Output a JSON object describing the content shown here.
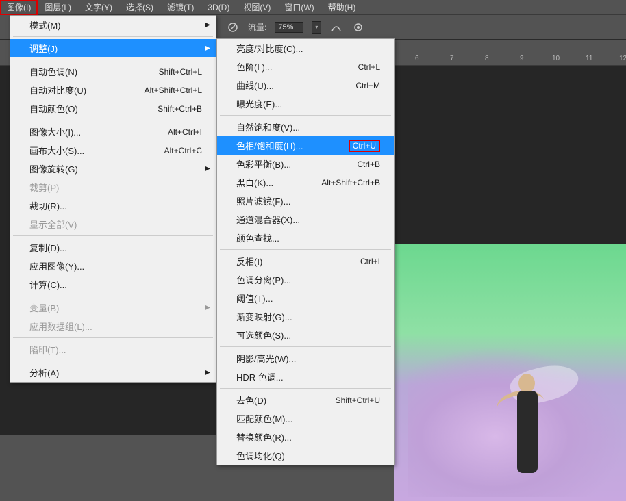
{
  "menubar": {
    "items": [
      "图像(I)",
      "图层(L)",
      "文字(Y)",
      "选择(S)",
      "滤镜(T)",
      "3D(D)",
      "视图(V)",
      "窗口(W)",
      "帮助(H)"
    ]
  },
  "toolbar": {
    "flow_label": "流量:",
    "flow_value": "75%"
  },
  "ruler": {
    "ticks": [
      "6",
      "7",
      "8",
      "9",
      "10",
      "11",
      "12"
    ]
  },
  "menu1": {
    "groups": [
      [
        {
          "label": "模式(M)",
          "arrow": true
        }
      ],
      [
        {
          "label": "调整(J)",
          "arrow": true,
          "hover": true
        }
      ],
      [
        {
          "label": "自动色调(N)",
          "sc": "Shift+Ctrl+L"
        },
        {
          "label": "自动对比度(U)",
          "sc": "Alt+Shift+Ctrl+L"
        },
        {
          "label": "自动颜色(O)",
          "sc": "Shift+Ctrl+B"
        }
      ],
      [
        {
          "label": "图像大小(I)...",
          "sc": "Alt+Ctrl+I"
        },
        {
          "label": "画布大小(S)...",
          "sc": "Alt+Ctrl+C"
        },
        {
          "label": "图像旋转(G)",
          "arrow": true
        },
        {
          "label": "裁剪(P)",
          "disabled": true
        },
        {
          "label": "裁切(R)..."
        },
        {
          "label": "显示全部(V)",
          "disabled": true
        }
      ],
      [
        {
          "label": "复制(D)..."
        },
        {
          "label": "应用图像(Y)..."
        },
        {
          "label": "计算(C)..."
        }
      ],
      [
        {
          "label": "变量(B)",
          "arrow": true,
          "disabled": true
        },
        {
          "label": "应用数据组(L)...",
          "disabled": true
        }
      ],
      [
        {
          "label": "陷印(T)...",
          "disabled": true
        }
      ],
      [
        {
          "label": "分析(A)",
          "arrow": true
        }
      ]
    ]
  },
  "menu2": {
    "groups": [
      [
        {
          "label": "亮度/对比度(C)..."
        },
        {
          "label": "色阶(L)...",
          "sc": "Ctrl+L"
        },
        {
          "label": "曲线(U)...",
          "sc": "Ctrl+M"
        },
        {
          "label": "曝光度(E)..."
        }
      ],
      [
        {
          "label": "自然饱和度(V)..."
        },
        {
          "label": "色相/饱和度(H)...",
          "sc": "Ctrl+U",
          "hover": true,
          "redbox": true
        },
        {
          "label": "色彩平衡(B)...",
          "sc": "Ctrl+B"
        },
        {
          "label": "黑白(K)...",
          "sc": "Alt+Shift+Ctrl+B"
        },
        {
          "label": "照片滤镜(F)..."
        },
        {
          "label": "通道混合器(X)..."
        },
        {
          "label": "颜色查找..."
        }
      ],
      [
        {
          "label": "反相(I)",
          "sc": "Ctrl+I"
        },
        {
          "label": "色调分离(P)..."
        },
        {
          "label": "阈值(T)..."
        },
        {
          "label": "渐变映射(G)..."
        },
        {
          "label": "可选颜色(S)..."
        }
      ],
      [
        {
          "label": "阴影/高光(W)..."
        },
        {
          "label": "HDR 色调..."
        }
      ],
      [
        {
          "label": "去色(D)",
          "sc": "Shift+Ctrl+U"
        },
        {
          "label": "匹配颜色(M)..."
        },
        {
          "label": "替换颜色(R)..."
        },
        {
          "label": "色调均化(Q)"
        }
      ]
    ]
  }
}
